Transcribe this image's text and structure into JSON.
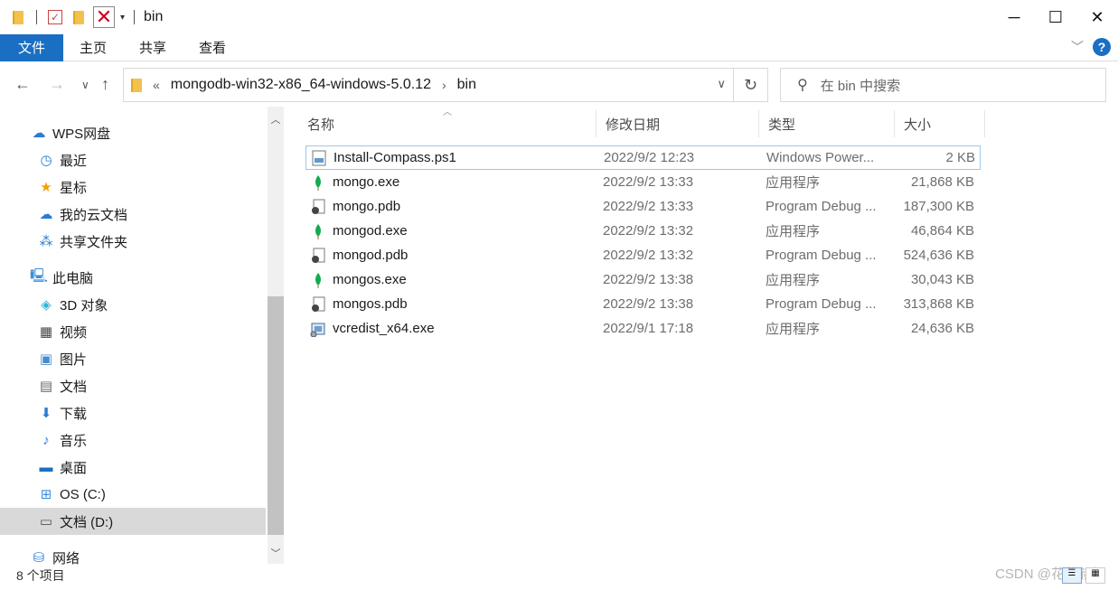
{
  "window": {
    "title": "bin"
  },
  "ribbon": {
    "tabs": [
      "文件",
      "主页",
      "共享",
      "查看"
    ]
  },
  "address": {
    "overflow": "«",
    "path": [
      "mongodb-win32-x86_64-windows-5.0.12",
      "bin"
    ]
  },
  "search": {
    "placeholder": "在 bin 中搜索"
  },
  "sidebar": {
    "items": [
      {
        "label": "WPS网盘",
        "icon": "cloud-icon"
      },
      {
        "label": "最近",
        "icon": "clock-icon"
      },
      {
        "label": "星标",
        "icon": "star-icon"
      },
      {
        "label": "我的云文档",
        "icon": "cloud-doc-icon"
      },
      {
        "label": "共享文件夹",
        "icon": "share-icon"
      },
      {
        "label": "此电脑",
        "icon": "computer-icon"
      },
      {
        "label": "3D 对象",
        "icon": "cube-icon"
      },
      {
        "label": "视频",
        "icon": "film-icon"
      },
      {
        "label": "图片",
        "icon": "image-icon"
      },
      {
        "label": "文档",
        "icon": "document-icon"
      },
      {
        "label": "下载",
        "icon": "download-icon"
      },
      {
        "label": "音乐",
        "icon": "music-icon"
      },
      {
        "label": "桌面",
        "icon": "desktop-icon"
      },
      {
        "label": "OS (C:)",
        "icon": "drive-icon"
      },
      {
        "label": "文档 (D:)",
        "icon": "drive-icon"
      },
      {
        "label": "网络",
        "icon": "network-icon"
      }
    ]
  },
  "columns": [
    "名称",
    "修改日期",
    "类型",
    "大小"
  ],
  "files": [
    {
      "name": "Install-Compass.ps1",
      "date": "2022/9/2 12:23",
      "type": "Windows Power...",
      "size": "2 KB",
      "icon": "script-icon"
    },
    {
      "name": "mongo.exe",
      "date": "2022/9/2 13:33",
      "type": "应用程序",
      "size": "21,868 KB",
      "icon": "mongo-leaf-icon"
    },
    {
      "name": "mongo.pdb",
      "date": "2022/9/2 13:33",
      "type": "Program Debug ...",
      "size": "187,300 KB",
      "icon": "pdb-icon"
    },
    {
      "name": "mongod.exe",
      "date": "2022/9/2 13:32",
      "type": "应用程序",
      "size": "46,864 KB",
      "icon": "mongo-leaf-icon"
    },
    {
      "name": "mongod.pdb",
      "date": "2022/9/2 13:32",
      "type": "Program Debug ...",
      "size": "524,636 KB",
      "icon": "pdb-icon"
    },
    {
      "name": "mongos.exe",
      "date": "2022/9/2 13:38",
      "type": "应用程序",
      "size": "30,043 KB",
      "icon": "mongo-leaf-icon"
    },
    {
      "name": "mongos.pdb",
      "date": "2022/9/2 13:38",
      "type": "Program Debug ...",
      "size": "313,868 KB",
      "icon": "pdb-icon"
    },
    {
      "name": "vcredist_x64.exe",
      "date": "2022/9/1 17:18",
      "type": "应用程序",
      "size": "24,636 KB",
      "icon": "installer-icon"
    }
  ],
  "status": {
    "count": "8 个项目"
  },
  "watermark": "CSDN @花花叔叔",
  "colors": {
    "accent": "#1a6fc2",
    "selection_border": "#99c9ef",
    "selected_nav": "#d9d9d9"
  }
}
